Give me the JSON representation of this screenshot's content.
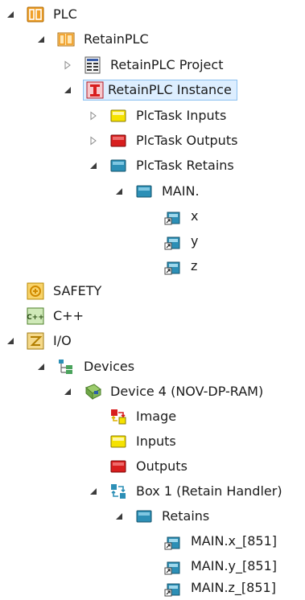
{
  "tree": {
    "nodes": [
      {
        "label": "PLC",
        "icon": "plc-icon",
        "toggle": "expanded"
      },
      {
        "label": "RetainPLC",
        "icon": "plc-project-icon",
        "toggle": "expanded"
      },
      {
        "label": "RetainPLC Project",
        "icon": "project-file-icon",
        "toggle": "collapsed"
      },
      {
        "label": "RetainPLC Instance",
        "icon": "plc-instance-icon",
        "toggle": "expanded",
        "selected": true
      },
      {
        "label": "PlcTask Inputs",
        "icon": "inputs-icon",
        "toggle": "collapsed"
      },
      {
        "label": "PlcTask Outputs",
        "icon": "outputs-icon",
        "toggle": "collapsed"
      },
      {
        "label": "PlcTask Retains",
        "icon": "retains-icon",
        "toggle": "expanded"
      },
      {
        "label": "MAIN.",
        "icon": "retains-icon",
        "toggle": "expanded"
      },
      {
        "label": "x",
        "icon": "variable-icon",
        "toggle": "none"
      },
      {
        "label": "y",
        "icon": "variable-icon",
        "toggle": "none"
      },
      {
        "label": "z",
        "icon": "variable-icon",
        "toggle": "none"
      },
      {
        "label": "SAFETY",
        "icon": "safety-icon",
        "toggle": "none"
      },
      {
        "label": "C++",
        "icon": "cpp-icon",
        "toggle": "none"
      },
      {
        "label": "I/O",
        "icon": "io-icon",
        "toggle": "expanded"
      },
      {
        "label": "Devices",
        "icon": "devices-icon",
        "toggle": "expanded"
      },
      {
        "label": "Device 4 (NOV-DP-RAM)",
        "icon": "device-icon",
        "toggle": "expanded"
      },
      {
        "label": "Image",
        "icon": "image-icon",
        "toggle": "none"
      },
      {
        "label": "Inputs",
        "icon": "inputs-icon",
        "toggle": "none"
      },
      {
        "label": "Outputs",
        "icon": "outputs-icon",
        "toggle": "none"
      },
      {
        "label": "Box 1 (Retain Handler)",
        "icon": "box-icon",
        "toggle": "expanded"
      },
      {
        "label": "Retains",
        "icon": "retains-icon",
        "toggle": "expanded"
      },
      {
        "label": "MAIN.x_[851]",
        "icon": "variable-icon",
        "toggle": "none"
      },
      {
        "label": "MAIN.y_[851]",
        "icon": "variable-icon",
        "toggle": "none"
      },
      {
        "label": "MAIN.z_[851]",
        "icon": "variable-icon",
        "toggle": "none"
      }
    ]
  },
  "colors": {
    "selection_bg": "#ddeeff",
    "selection_border": "#8cc0f0",
    "plc_orange": "#f0a028",
    "inputs_yellow": "#f5e200",
    "outputs_red": "#d81e1e",
    "retains_teal": "#2c8fb6"
  }
}
